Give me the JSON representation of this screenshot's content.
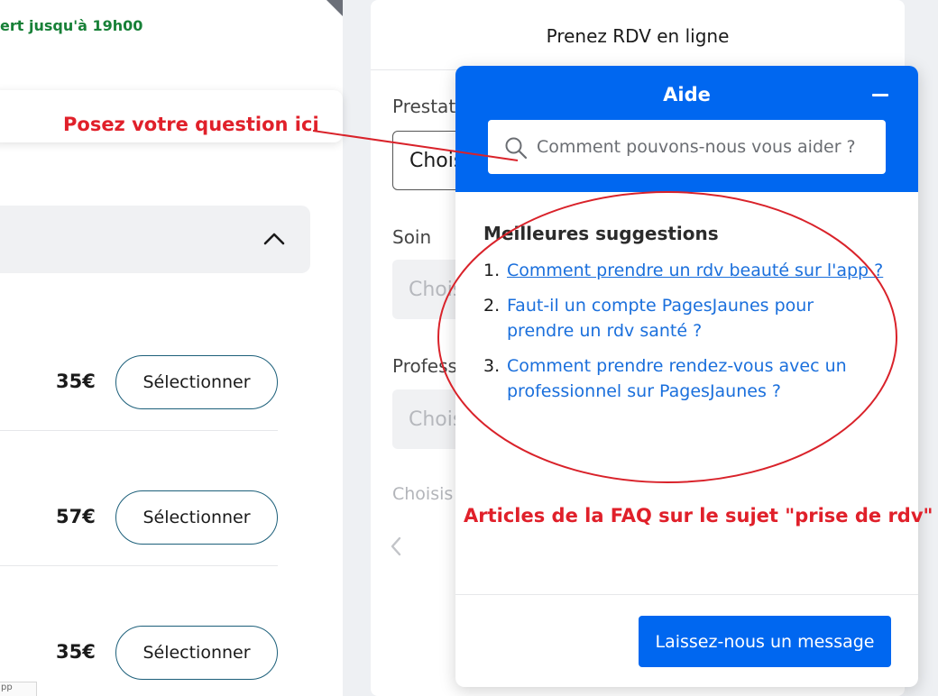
{
  "left_panel": {
    "open_status": "ert jusqu'à 19h00",
    "services": [
      {
        "price": "35€",
        "button": "Sélectionner"
      },
      {
        "price": "57€",
        "button": "Sélectionner"
      },
      {
        "price": "35€",
        "button": "Sélectionner"
      }
    ],
    "mini_tag": "pp"
  },
  "booking": {
    "title": "Prenez RDV en ligne",
    "fields": [
      {
        "label": "Prestat",
        "value": "Chois"
      },
      {
        "label": "Soin",
        "value": "Chois"
      },
      {
        "label": "Profess",
        "value": "Chois"
      }
    ],
    "choose_text": "Choisis"
  },
  "help_widget": {
    "title": "Aide",
    "search_placeholder": "Comment pouvons-nous vous aider ?",
    "suggestions_title": "Meilleures suggestions",
    "suggestions": [
      {
        "num": "1.",
        "text": "Comment prendre un rdv beauté sur l'app ?"
      },
      {
        "num": "2.",
        "text": "Faut-il un compte PagesJaunes pour prendre un rdv santé ?"
      },
      {
        "num": "3.",
        "text": "Comment prendre rendez-vous avec un professionnel sur PagesJaunes ?"
      }
    ],
    "message_button": "Laissez-nous un message",
    "brand_color": "#0067f0"
  },
  "annotations": {
    "question_here": "Posez votre question ici",
    "faq_articles": "Articles de la FAQ sur le sujet \"prise de rdv\"",
    "annotation_color": "#e0202a"
  }
}
